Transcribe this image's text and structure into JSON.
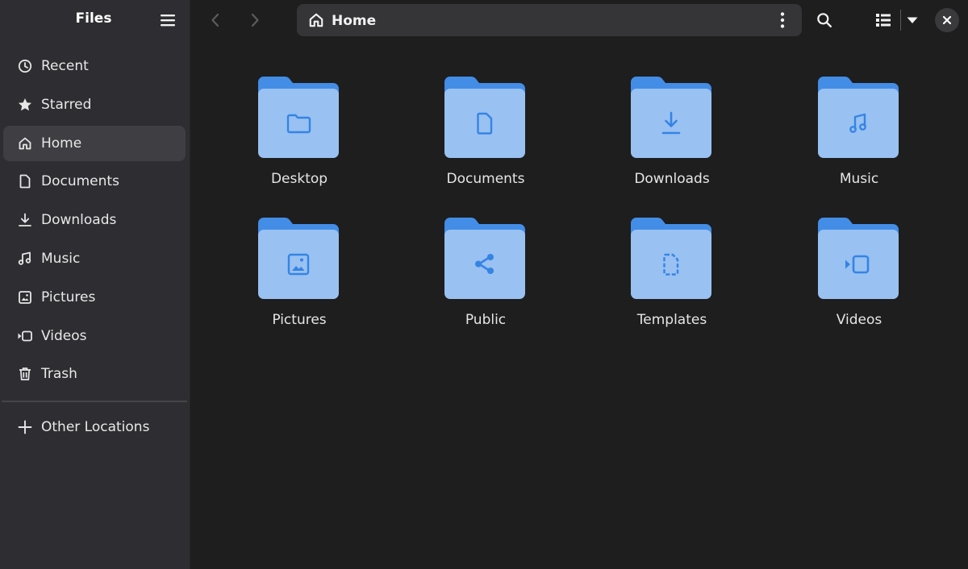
{
  "app": {
    "title": "Files"
  },
  "sidebar": {
    "items": [
      {
        "label": "Recent",
        "icon": "clock-icon"
      },
      {
        "label": "Starred",
        "icon": "star-icon"
      },
      {
        "label": "Home",
        "icon": "home-icon",
        "active": true
      },
      {
        "label": "Documents",
        "icon": "document-icon"
      },
      {
        "label": "Downloads",
        "icon": "download-icon"
      },
      {
        "label": "Music",
        "icon": "music-icon"
      },
      {
        "label": "Pictures",
        "icon": "image-icon"
      },
      {
        "label": "Videos",
        "icon": "video-icon"
      },
      {
        "label": "Trash",
        "icon": "trash-icon"
      }
    ],
    "other_locations": {
      "label": "Other Locations",
      "icon": "plus-icon"
    }
  },
  "pathbar": {
    "label": "Home"
  },
  "folders": [
    {
      "name": "Desktop",
      "icon": "folder-icon"
    },
    {
      "name": "Documents",
      "icon": "document-icon"
    },
    {
      "name": "Downloads",
      "icon": "download-icon"
    },
    {
      "name": "Music",
      "icon": "music-icon"
    },
    {
      "name": "Pictures",
      "icon": "image-icon"
    },
    {
      "name": "Public",
      "icon": "share-icon"
    },
    {
      "name": "Templates",
      "icon": "template-icon"
    },
    {
      "name": "Videos",
      "icon": "video-icon"
    }
  ],
  "colors": {
    "accent": "#3584e4",
    "folder_back": "#438de6",
    "folder_front": "#99c1f1",
    "sidebar_bg": "#2e2e32",
    "content_bg": "#1e1e1e"
  }
}
